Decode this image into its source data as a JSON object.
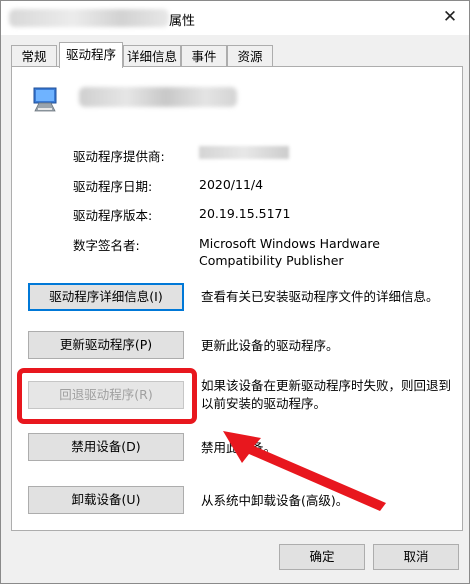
{
  "window": {
    "title": "属性",
    "close_glyph": "✕"
  },
  "tabs": [
    {
      "label": "常规"
    },
    {
      "label": "驱动程序"
    },
    {
      "label": "详细信息"
    },
    {
      "label": "事件"
    },
    {
      "label": "资源"
    }
  ],
  "driver_info": {
    "provider_label": "驱动程序提供商:",
    "date_label": "驱动程序日期:",
    "date_value": "2020/11/4",
    "version_label": "驱动程序版本:",
    "version_value": "20.19.15.5171",
    "signer_label": "数字签名者:",
    "signer_value_line1": "Microsoft Windows Hardware",
    "signer_value_line2": "Compatibility Publisher"
  },
  "actions": [
    {
      "label": "驱动程序详细信息(I)",
      "description": "查看有关已安装驱动程序文件的详细信息。"
    },
    {
      "label": "更新驱动程序(P)",
      "description": "更新此设备的驱动程序。"
    },
    {
      "label": "回退驱动程序(R)",
      "description_line1": "如果该设备在更新驱动程序时失败，则回退到",
      "description_line2": "以前安装的驱动程序。"
    },
    {
      "label": "禁用设备(D)",
      "description": "禁用此设备。"
    },
    {
      "label": "卸载设备(U)",
      "description": "从系统中卸载设备(高级)。"
    }
  ],
  "footer": {
    "ok_label": "确定",
    "cancel_label": "取消"
  },
  "colors": {
    "annotation_red": "#e8171e",
    "focus_blue": "#0078d7"
  },
  "icons": {
    "device": "monitor-device-icon",
    "close": "close-icon"
  }
}
